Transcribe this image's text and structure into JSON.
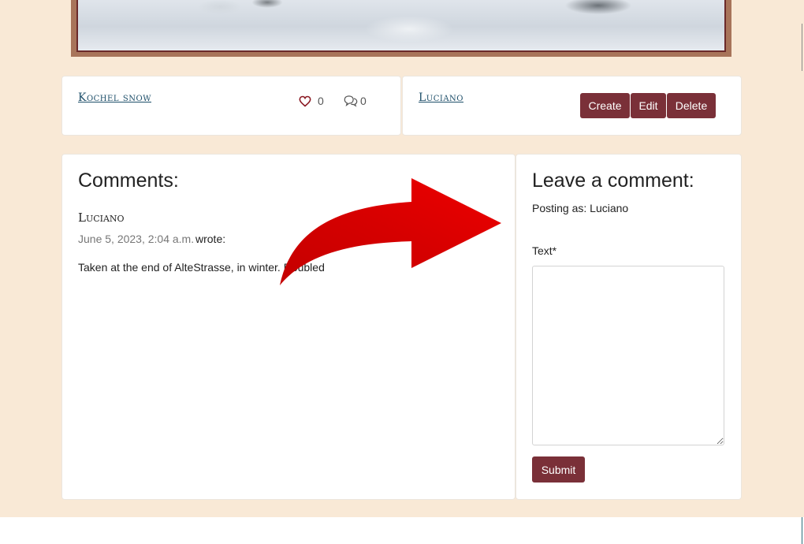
{
  "post": {
    "title": "Kochel snow",
    "likes": "0",
    "comments_count": "0",
    "author": "Luciano",
    "buttons": {
      "create": "Create",
      "edit": "Edit",
      "delete": "Delete"
    }
  },
  "comments": {
    "heading": "Comments:",
    "items": [
      {
        "author": "Luciano",
        "date": "June 5, 2023, 2:04 a.m.",
        "wrote": "wrote:",
        "body": "Taken at the end of AlteStrasse, in winter. Doubled"
      }
    ]
  },
  "comment_form": {
    "heading": "Leave a comment:",
    "posting_as": "Posting as: Luciano",
    "text_label": "Text*",
    "text_value": "",
    "submit": "Submit"
  },
  "colors": {
    "accent": "#7a3038",
    "background": "#f9e9d6",
    "arrow": "#e60000"
  }
}
